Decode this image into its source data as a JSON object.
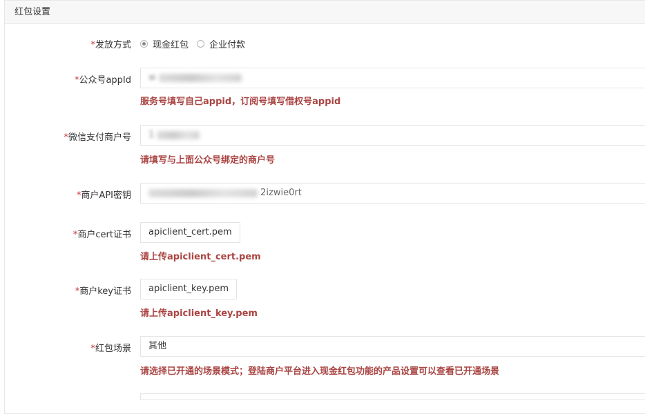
{
  "panel": {
    "title": "红包设置"
  },
  "required_mark": "*",
  "form": {
    "send_method": {
      "label": "发放方式",
      "options": [
        {
          "label": "现金红包",
          "checked": true
        },
        {
          "label": "企业付款",
          "checked": false
        }
      ]
    },
    "appid": {
      "label": "公众号appId",
      "value": "w",
      "value_obscured": true,
      "help": "服务号填写自己appid，订阅号填写借权号appid"
    },
    "merchant_id": {
      "label": "微信支付商户号",
      "value": "1",
      "value_obscured": true,
      "help": "请填写与上面公众号绑定的商户号"
    },
    "api_key": {
      "label": "商户API密钥",
      "value_visible_tail": "2izwie0rt",
      "value_obscured": true
    },
    "cert_file": {
      "label": "商户cert证书",
      "value": "apiclient_cert.pem",
      "help": "请上传apiclient_cert.pem"
    },
    "key_file": {
      "label": "商户key证书",
      "value": "apiclient_key.pem",
      "help": "请上传apiclient_key.pem"
    },
    "scene": {
      "label": "红包场景",
      "value": "其他",
      "help": "请选择已开通的场景模式；登陆商户平台进入现金红包功能的产品设置可以查看已开通场景"
    }
  },
  "colors": {
    "required": "#cc3333",
    "help_text": "#a94442",
    "header_bg": "#f7f7f7",
    "border": "#e5e5e5"
  }
}
